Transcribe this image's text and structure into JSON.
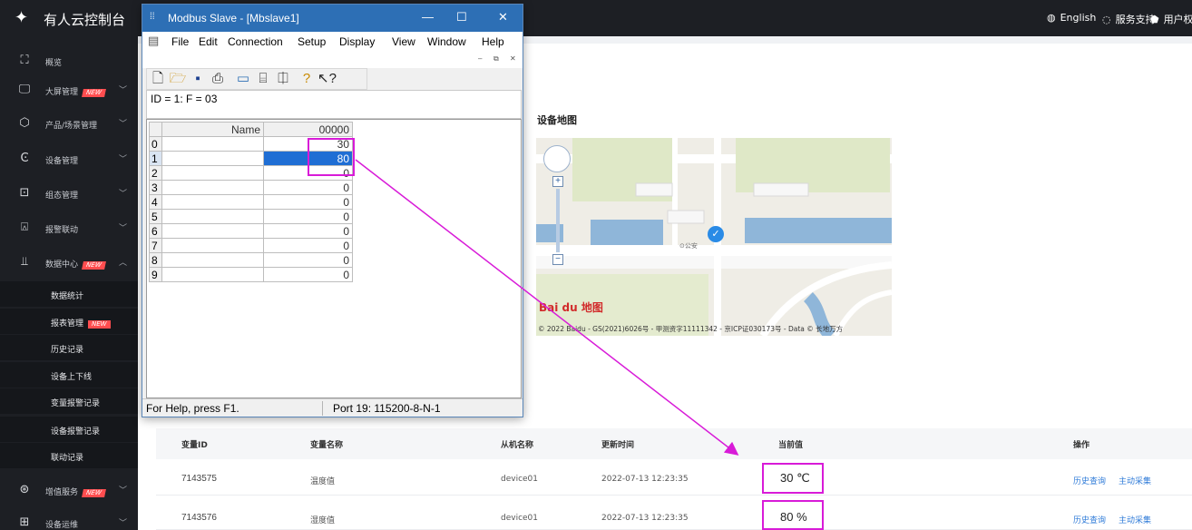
{
  "topbar": {
    "brand": "有人云控制台",
    "items": [
      {
        "icon": "globe-icon",
        "glyph": "🌐",
        "label": "English"
      },
      {
        "icon": "support-icon",
        "glyph": "◌",
        "label": "服务支持"
      },
      {
        "icon": "shield-icon",
        "glyph": "⬟",
        "label": "用户权限"
      }
    ]
  },
  "sidebar": {
    "items": [
      {
        "icon": "overview-icon",
        "glyph": "⛶",
        "label": "概览",
        "badge": "",
        "caret": ""
      },
      {
        "icon": "screen-icon",
        "glyph": "🖵",
        "label": "大屏管理",
        "badge": "NEW",
        "caret": "﹀"
      },
      {
        "icon": "cube-icon",
        "glyph": "⬡",
        "label": "产品/场景管理",
        "badge": "",
        "caret": "﹀"
      },
      {
        "icon": "device-icon",
        "glyph": "Ͼ",
        "label": "设备管理",
        "badge": "",
        "caret": "﹀"
      },
      {
        "icon": "config-icon",
        "glyph": "⊡",
        "label": "组态管理",
        "badge": "",
        "caret": "﹀"
      },
      {
        "icon": "alarm-icon",
        "glyph": "⍓",
        "label": "报警联动",
        "badge": "",
        "caret": "﹀"
      },
      {
        "icon": "chart-icon",
        "glyph": "⫫",
        "label": "数据中心",
        "badge": "NEW",
        "caret": "︿"
      }
    ],
    "sub_items": [
      {
        "label": "数据统计",
        "badge": ""
      },
      {
        "label": "报表管理",
        "badge": "NEW"
      },
      {
        "label": "历史记录",
        "badge": ""
      },
      {
        "label": "设备上下线",
        "badge": ""
      },
      {
        "label": "变量报警记录",
        "badge": ""
      },
      {
        "label": "设备报警记录",
        "badge": ""
      },
      {
        "label": "联动记录",
        "badge": ""
      }
    ],
    "bottom_items": [
      {
        "icon": "value-icon",
        "glyph": "⊛",
        "label": "增值服务",
        "badge": "NEW",
        "caret": "﹀"
      },
      {
        "icon": "ops-icon",
        "glyph": "⊞",
        "label": "设备运维",
        "badge": "",
        "caret": "﹀"
      }
    ]
  },
  "map": {
    "title": "设备地图",
    "logo": "Bai du 地图",
    "poi": "⊙公安",
    "copyright": "© 2022 Baidu - GS(2021)6026号 - 甲测资字11111342 - 京ICP证030173号 - Data © 长地万方"
  },
  "table": {
    "headers": [
      "变量ID",
      "变量名称",
      "从机名称",
      "更新时间",
      "当前值",
      "操作"
    ],
    "rows": [
      {
        "id": "7143575",
        "name": "温度值",
        "slave": "device01",
        "time": "2022-07-13 12:23:35",
        "value": "30 ℃",
        "action1": "历史查询",
        "action2": "主动采集"
      },
      {
        "id": "7143576",
        "name": "湿度值",
        "slave": "device01",
        "time": "2022-07-13 12:23:35",
        "value": "80 %",
        "action1": "历史查询",
        "action2": "主动采集"
      }
    ]
  },
  "modbus": {
    "title": "Modbus Slave - [Mbslave1]",
    "menus": [
      "File",
      "Edit",
      "Connection",
      "Setup",
      "Display",
      "View",
      "Window",
      "Help"
    ],
    "id_line": "ID = 1: F = 03",
    "grid": {
      "col_name": "Name",
      "col_addr": "00000",
      "rows": [
        {
          "idx": "0",
          "name": "",
          "value": "30"
        },
        {
          "idx": "1",
          "name": "",
          "value": "80"
        },
        {
          "idx": "2",
          "name": "",
          "value": "0"
        },
        {
          "idx": "3",
          "name": "",
          "value": "0"
        },
        {
          "idx": "4",
          "name": "",
          "value": "0"
        },
        {
          "idx": "5",
          "name": "",
          "value": "0"
        },
        {
          "idx": "6",
          "name": "",
          "value": "0"
        },
        {
          "idx": "7",
          "name": "",
          "value": "0"
        },
        {
          "idx": "8",
          "name": "",
          "value": "0"
        },
        {
          "idx": "9",
          "name": "",
          "value": "0"
        }
      ],
      "selected_row": 1
    },
    "status_help": "For Help, press F1.",
    "status_port": "Port 19: 115200-8-N-1"
  },
  "colors": {
    "annotation": "#d81bd8",
    "link": "#2f7bd8",
    "title_bar": "#2d6fb5"
  }
}
